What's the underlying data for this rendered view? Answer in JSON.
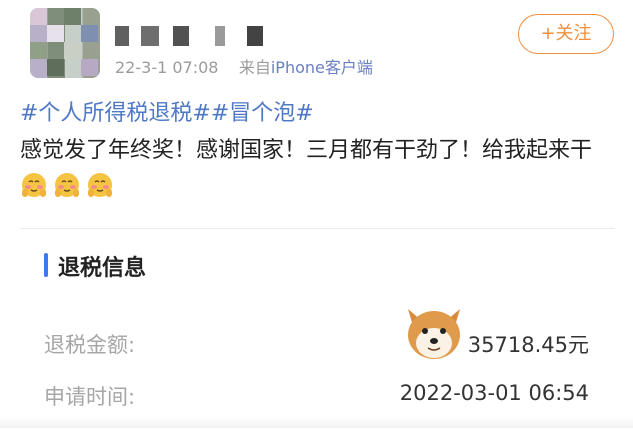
{
  "post": {
    "timestamp": "22-3-1 07:08",
    "source_prefix": "来自",
    "source": "iPhone客户端",
    "follow_label": "+关注",
    "hashtags": "#个人所得税退税##冒个泡#",
    "text": "感觉发了年终奖！感谢国家！三月都有干劲了！给我起来干",
    "emojis": [
      "shy-face-emoji",
      "shy-face-emoji",
      "shy-face-emoji"
    ]
  },
  "card": {
    "title": "退税信息",
    "rows": [
      {
        "label": "退税金额:",
        "value": "35718.45元"
      },
      {
        "label": "申请时间:",
        "value": "2022-03-01 06:54"
      }
    ]
  },
  "colors": {
    "accent": "#f08f3f",
    "link": "#4f78c7",
    "card_marker": "#3f78f0"
  }
}
